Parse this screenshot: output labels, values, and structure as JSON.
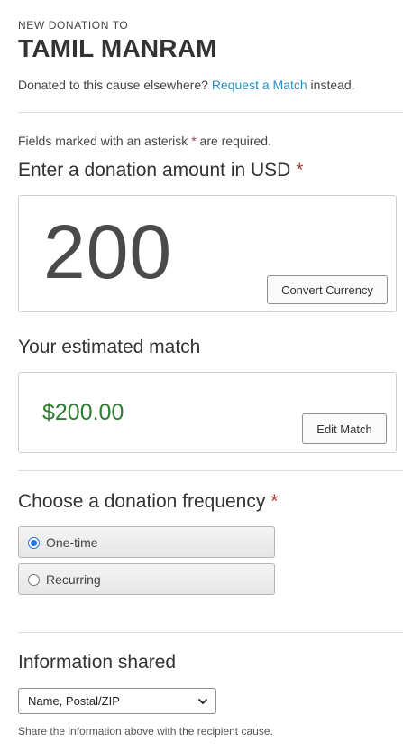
{
  "header": {
    "kicker": "NEW DONATION TO",
    "title": "TAMIL MANRAM",
    "elsewhere_prefix": "Donated to this cause elsewhere? ",
    "elsewhere_link": "Request a Match",
    "elsewhere_suffix": " instead."
  },
  "required_note": {
    "prefix": "Fields marked with an asterisk ",
    "asterisk": "*",
    "suffix": " are required."
  },
  "amount_section": {
    "heading": "Enter a donation amount in USD",
    "asterisk": "*",
    "amount": "200",
    "convert_label": "Convert Currency"
  },
  "match_section": {
    "heading": "Your estimated match",
    "value": "$200.00",
    "edit_label": "Edit Match"
  },
  "frequency_section": {
    "heading": "Choose a donation frequency",
    "asterisk": "*",
    "options": [
      {
        "label": "One-time",
        "selected": true
      },
      {
        "label": "Recurring",
        "selected": false
      }
    ]
  },
  "info_section": {
    "heading": "Information shared",
    "selected_option": "Name, Postal/ZIP",
    "note": "Share the information above with the recipient cause."
  },
  "colors": {
    "link": "#2a8fc9",
    "required": "#a33b3b",
    "match_value": "#2e7d32",
    "radio_selected": "#1a73e8"
  },
  "icons": {
    "select_arrow": "chevron-down-icon"
  }
}
